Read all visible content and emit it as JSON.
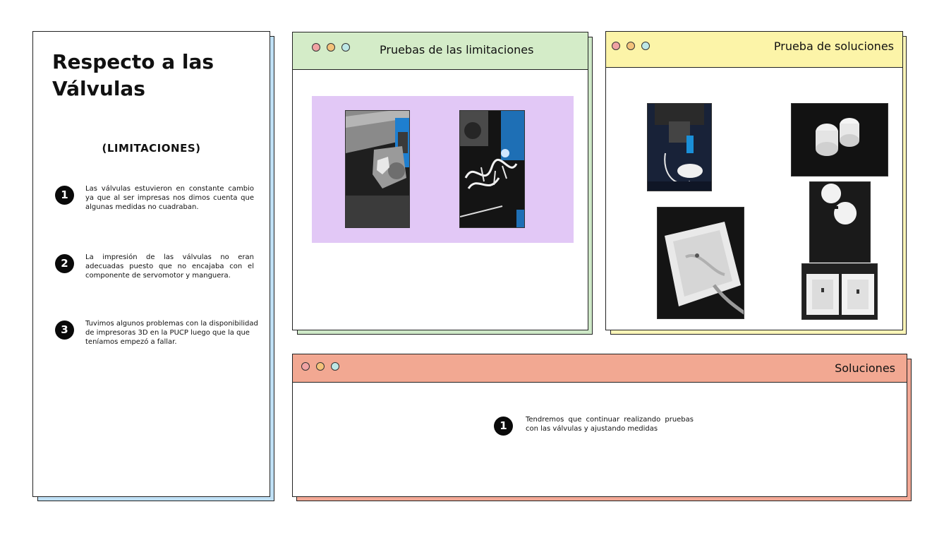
{
  "left_card": {
    "title": "Respecto a las Válvulas",
    "subtitle": "(LIMITACIONES)",
    "items": [
      {
        "number": "1",
        "text": "Las válvulas estuvieron en constante cambio ya que al ser impresas nos dimos cuenta que algunas medidas no cuadraban."
      },
      {
        "number": "2",
        "text": "La impresión de las válvulas no eran adecuadas puesto que no encajaba con el componente de servomotor y manguera."
      },
      {
        "number": "3",
        "text": "Tuvimos algunos problemas con la disponibilidad de impresoras 3D en la PUCP luego que la que teníamos empezó a fallar."
      }
    ]
  },
  "windows": {
    "limitaciones": {
      "title": "Pruebas de las limitaciones"
    },
    "soluciones_prueba": {
      "title": "Prueba de soluciones"
    },
    "soluciones": {
      "title": "Soluciones",
      "items": [
        {
          "number": "1",
          "text": "Tendremos que continuar realizando pruebas con las válvulas y ajustando medidas"
        }
      ]
    }
  },
  "colors": {
    "dot_red": "#f0a3a3",
    "dot_orange": "#f3c27a",
    "dot_teal": "#bde8e6",
    "green_bar": "#d4ecc8",
    "yellow_bar": "#fcf4a8",
    "salmon_bar": "#f2a892",
    "blue_shadow": "#bfe0f5",
    "purple_panel": "#e2c8f6"
  },
  "icons": [
    "window-dot-red",
    "window-dot-orange",
    "window-dot-teal"
  ]
}
